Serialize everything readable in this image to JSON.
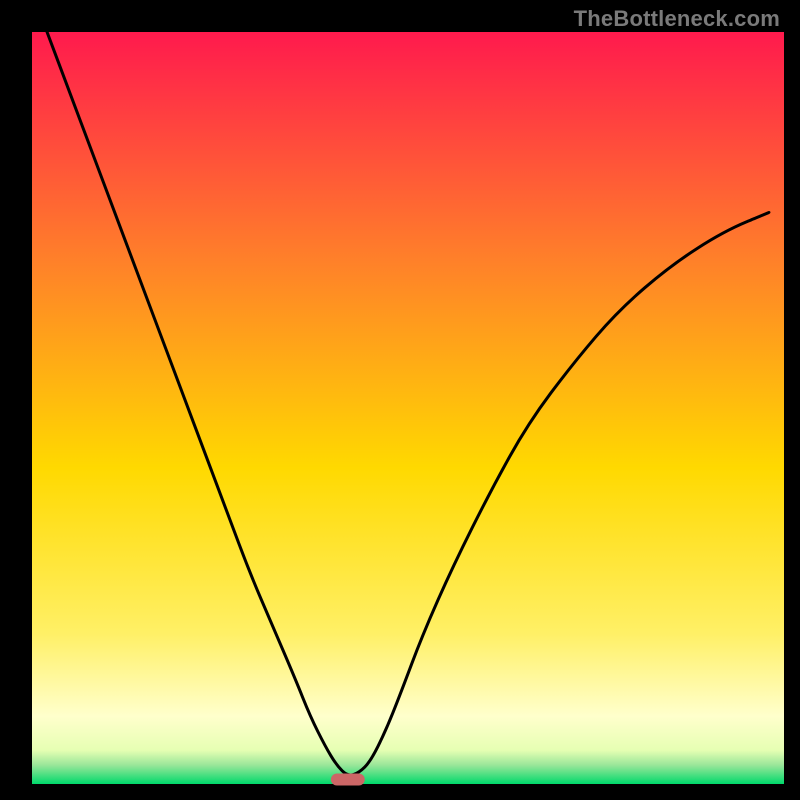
{
  "attribution": "TheBottleneck.com",
  "chart_data": {
    "type": "line",
    "title": "",
    "xlabel": "",
    "ylabel": "",
    "xlim": [
      0,
      100
    ],
    "ylim": [
      0,
      100
    ],
    "grid": false,
    "legend": false,
    "background_gradient": {
      "top": "#ff1a4d",
      "mid_upper": "#ff7f2a",
      "mid": "#ffd900",
      "mid_lower": "#fff066",
      "lower_band": "#ffffcc",
      "bottom": "#00d96b"
    },
    "series": [
      {
        "name": "bottleneck-curve",
        "stroke": "#000000",
        "x": [
          2,
          5,
          8,
          11,
          14,
          17,
          20,
          23,
          26,
          29,
          32,
          35,
          37,
          39,
          40.5,
          42,
          43.5,
          45,
          47,
          49,
          52,
          56,
          61,
          66,
          72,
          78,
          85,
          92,
          98
        ],
        "y": [
          100,
          92,
          84,
          76,
          68,
          60,
          52,
          44,
          36,
          28,
          21,
          14,
          9,
          5,
          2.5,
          1,
          1.5,
          3,
          7,
          12,
          20,
          29,
          39,
          48,
          56,
          63,
          69,
          73.5,
          76
        ]
      }
    ],
    "marker": {
      "name": "optimum-marker",
      "x": 42,
      "y": 0.6,
      "color": "#cc6666",
      "width": 4.5,
      "height": 1.6
    }
  }
}
